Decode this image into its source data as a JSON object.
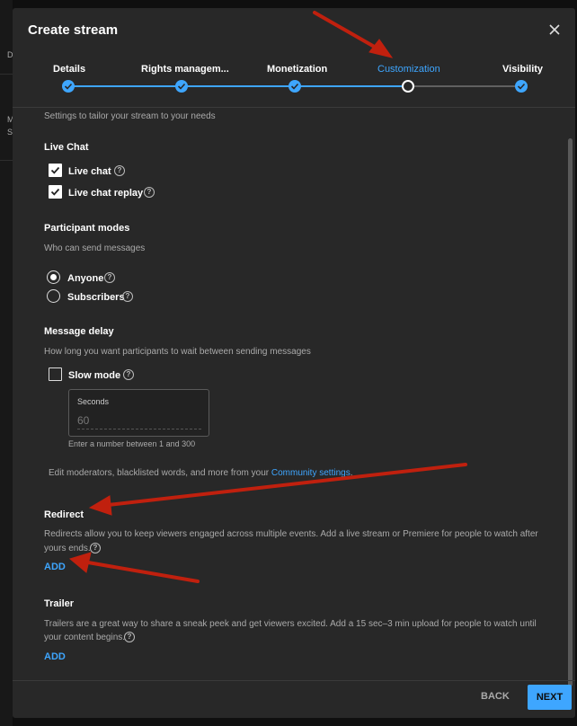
{
  "background_page": {
    "items": [
      "D",
      "M",
      "S"
    ]
  },
  "dialog": {
    "title": "Create stream",
    "close_icon": "close-icon"
  },
  "steps": [
    {
      "label": "Details",
      "state": "done"
    },
    {
      "label": "Rights managem...",
      "state": "done"
    },
    {
      "label": "Monetization",
      "state": "done"
    },
    {
      "label": "Customization",
      "state": "current"
    },
    {
      "label": "Visibility",
      "state": "done"
    }
  ],
  "intro_text": "Settings to tailor your stream to your needs",
  "live_chat": {
    "title": "Live Chat",
    "options": [
      {
        "label": "Live chat",
        "checked": true
      },
      {
        "label": "Live chat replay",
        "checked": true
      }
    ]
  },
  "participant_modes": {
    "title": "Participant modes",
    "subtitle": "Who can send messages",
    "options": [
      {
        "label": "Anyone",
        "selected": true
      },
      {
        "label": "Subscribers",
        "selected": false
      }
    ]
  },
  "message_delay": {
    "title": "Message delay",
    "subtitle": "How long you want participants to wait between sending messages",
    "slow_mode_label": "Slow mode",
    "slow_mode_checked": false,
    "seconds_label": "Seconds",
    "seconds_value": "60",
    "seconds_hint": "Enter a number between 1 and 300"
  },
  "community": {
    "text_before": "Edit moderators, blacklisted words, and more from your ",
    "link_text": "Community settings",
    "text_after": "."
  },
  "redirect": {
    "title": "Redirect",
    "desc_line1": "Redirects allow you to keep viewers engaged across multiple events. Add a live stream or Premiere for people to watch after",
    "desc_line2": "yours ends.",
    "add_label": "ADD"
  },
  "trailer": {
    "title": "Trailer",
    "desc_line1": "Trailers are a great way to share a sneak peek and get viewers excited. Add a 15 sec–3 min upload for people to watch until",
    "desc_line2": "your content begins.",
    "add_label": "ADD"
  },
  "footer": {
    "back_label": "BACK",
    "next_label": "NEXT"
  },
  "colors": {
    "accent": "#3ea6ff",
    "annotation_arrow": "#c0200e",
    "dialog_bg": "#282828"
  }
}
